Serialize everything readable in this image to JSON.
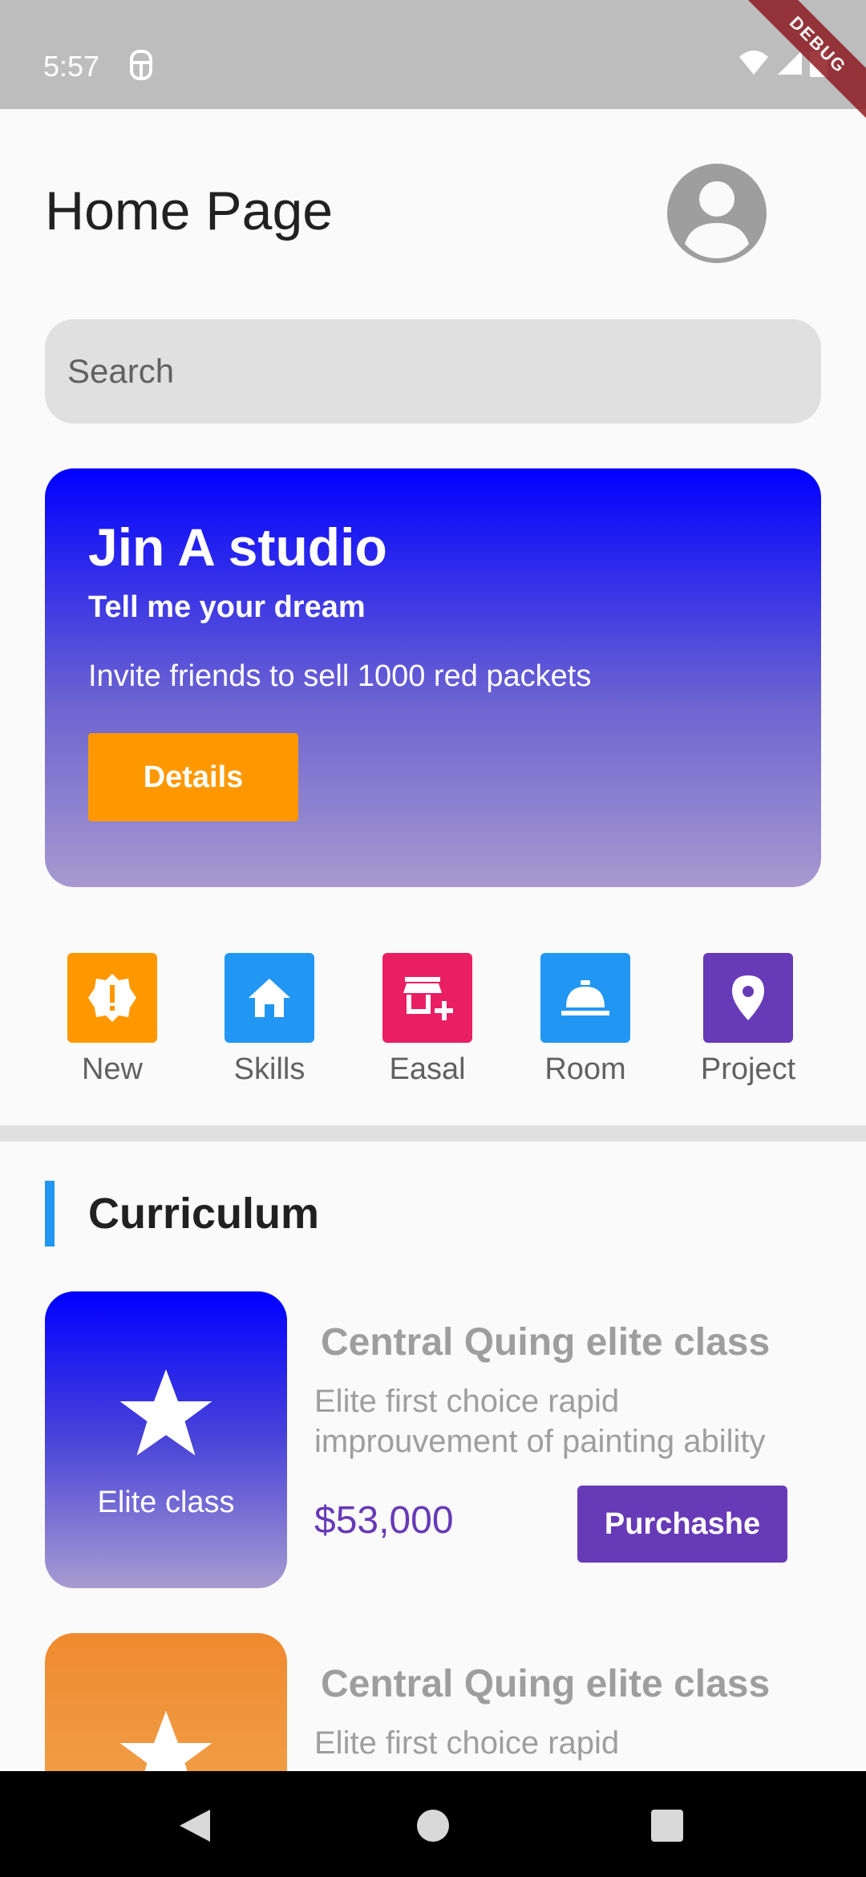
{
  "status_bar": {
    "time": "5:57",
    "debug_label": "DEBUG"
  },
  "header": {
    "title": "Home Page"
  },
  "search": {
    "placeholder": "Search"
  },
  "banner": {
    "title": "Jin A studio",
    "subtitle": "Tell me your dream",
    "description": "Invite friends to sell 1000 red packets",
    "button_label": "Details"
  },
  "categories": [
    {
      "label": "New",
      "icon": "new-releases-icon",
      "color": "#ff9800"
    },
    {
      "label": "Skills",
      "icon": "home-icon",
      "color": "#2196f3"
    },
    {
      "label": "Easal",
      "icon": "add-business-icon",
      "color": "#e91e63"
    },
    {
      "label": "Room",
      "icon": "room-service-icon",
      "color": "#2196f3"
    },
    {
      "label": "Project",
      "icon": "location-pin-icon",
      "color": "#673ab7"
    }
  ],
  "curriculum": {
    "section_title": "Curriculum",
    "courses": [
      {
        "thumb_label": "Elite class",
        "title": "Central Quing elite class",
        "description": "Elite first choice rapid improuvement of painting ability",
        "price": "$53,000",
        "button_label": "Purchashe"
      },
      {
        "title": "Central Quing elite class",
        "description": "Elite first choice rapid"
      }
    ]
  }
}
